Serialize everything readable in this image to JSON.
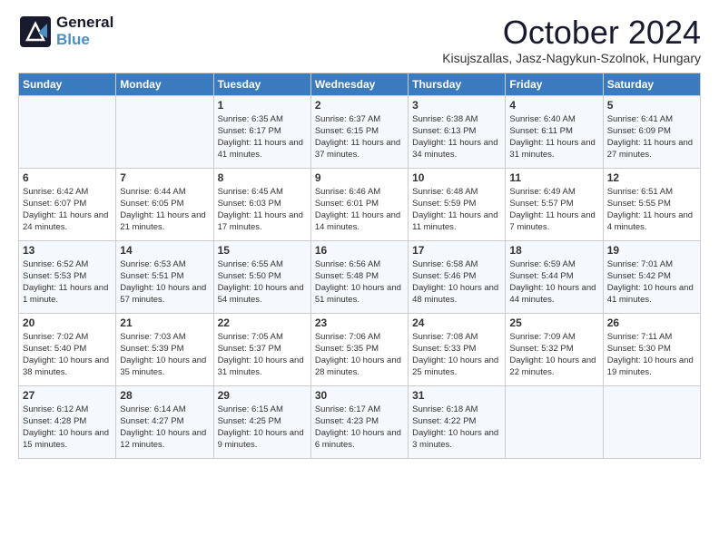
{
  "logo": {
    "general": "General",
    "blue": "Blue"
  },
  "header": {
    "title": "October 2024",
    "subtitle": "Kisujszallas, Jasz-Nagykun-Szolnok, Hungary"
  },
  "weekdays": [
    "Sunday",
    "Monday",
    "Tuesday",
    "Wednesday",
    "Thursday",
    "Friday",
    "Saturday"
  ],
  "weeks": [
    [
      {
        "day": "",
        "info": ""
      },
      {
        "day": "",
        "info": ""
      },
      {
        "day": "1",
        "info": "Sunrise: 6:35 AM\nSunset: 6:17 PM\nDaylight: 11 hours and 41 minutes."
      },
      {
        "day": "2",
        "info": "Sunrise: 6:37 AM\nSunset: 6:15 PM\nDaylight: 11 hours and 37 minutes."
      },
      {
        "day": "3",
        "info": "Sunrise: 6:38 AM\nSunset: 6:13 PM\nDaylight: 11 hours and 34 minutes."
      },
      {
        "day": "4",
        "info": "Sunrise: 6:40 AM\nSunset: 6:11 PM\nDaylight: 11 hours and 31 minutes."
      },
      {
        "day": "5",
        "info": "Sunrise: 6:41 AM\nSunset: 6:09 PM\nDaylight: 11 hours and 27 minutes."
      }
    ],
    [
      {
        "day": "6",
        "info": "Sunrise: 6:42 AM\nSunset: 6:07 PM\nDaylight: 11 hours and 24 minutes."
      },
      {
        "day": "7",
        "info": "Sunrise: 6:44 AM\nSunset: 6:05 PM\nDaylight: 11 hours and 21 minutes."
      },
      {
        "day": "8",
        "info": "Sunrise: 6:45 AM\nSunset: 6:03 PM\nDaylight: 11 hours and 17 minutes."
      },
      {
        "day": "9",
        "info": "Sunrise: 6:46 AM\nSunset: 6:01 PM\nDaylight: 11 hours and 14 minutes."
      },
      {
        "day": "10",
        "info": "Sunrise: 6:48 AM\nSunset: 5:59 PM\nDaylight: 11 hours and 11 minutes."
      },
      {
        "day": "11",
        "info": "Sunrise: 6:49 AM\nSunset: 5:57 PM\nDaylight: 11 hours and 7 minutes."
      },
      {
        "day": "12",
        "info": "Sunrise: 6:51 AM\nSunset: 5:55 PM\nDaylight: 11 hours and 4 minutes."
      }
    ],
    [
      {
        "day": "13",
        "info": "Sunrise: 6:52 AM\nSunset: 5:53 PM\nDaylight: 11 hours and 1 minute."
      },
      {
        "day": "14",
        "info": "Sunrise: 6:53 AM\nSunset: 5:51 PM\nDaylight: 10 hours and 57 minutes."
      },
      {
        "day": "15",
        "info": "Sunrise: 6:55 AM\nSunset: 5:50 PM\nDaylight: 10 hours and 54 minutes."
      },
      {
        "day": "16",
        "info": "Sunrise: 6:56 AM\nSunset: 5:48 PM\nDaylight: 10 hours and 51 minutes."
      },
      {
        "day": "17",
        "info": "Sunrise: 6:58 AM\nSunset: 5:46 PM\nDaylight: 10 hours and 48 minutes."
      },
      {
        "day": "18",
        "info": "Sunrise: 6:59 AM\nSunset: 5:44 PM\nDaylight: 10 hours and 44 minutes."
      },
      {
        "day": "19",
        "info": "Sunrise: 7:01 AM\nSunset: 5:42 PM\nDaylight: 10 hours and 41 minutes."
      }
    ],
    [
      {
        "day": "20",
        "info": "Sunrise: 7:02 AM\nSunset: 5:40 PM\nDaylight: 10 hours and 38 minutes."
      },
      {
        "day": "21",
        "info": "Sunrise: 7:03 AM\nSunset: 5:39 PM\nDaylight: 10 hours and 35 minutes."
      },
      {
        "day": "22",
        "info": "Sunrise: 7:05 AM\nSunset: 5:37 PM\nDaylight: 10 hours and 31 minutes."
      },
      {
        "day": "23",
        "info": "Sunrise: 7:06 AM\nSunset: 5:35 PM\nDaylight: 10 hours and 28 minutes."
      },
      {
        "day": "24",
        "info": "Sunrise: 7:08 AM\nSunset: 5:33 PM\nDaylight: 10 hours and 25 minutes."
      },
      {
        "day": "25",
        "info": "Sunrise: 7:09 AM\nSunset: 5:32 PM\nDaylight: 10 hours and 22 minutes."
      },
      {
        "day": "26",
        "info": "Sunrise: 7:11 AM\nSunset: 5:30 PM\nDaylight: 10 hours and 19 minutes."
      }
    ],
    [
      {
        "day": "27",
        "info": "Sunrise: 6:12 AM\nSunset: 4:28 PM\nDaylight: 10 hours and 15 minutes."
      },
      {
        "day": "28",
        "info": "Sunrise: 6:14 AM\nSunset: 4:27 PM\nDaylight: 10 hours and 12 minutes."
      },
      {
        "day": "29",
        "info": "Sunrise: 6:15 AM\nSunset: 4:25 PM\nDaylight: 10 hours and 9 minutes."
      },
      {
        "day": "30",
        "info": "Sunrise: 6:17 AM\nSunset: 4:23 PM\nDaylight: 10 hours and 6 minutes."
      },
      {
        "day": "31",
        "info": "Sunrise: 6:18 AM\nSunset: 4:22 PM\nDaylight: 10 hours and 3 minutes."
      },
      {
        "day": "",
        "info": ""
      },
      {
        "day": "",
        "info": ""
      }
    ]
  ]
}
